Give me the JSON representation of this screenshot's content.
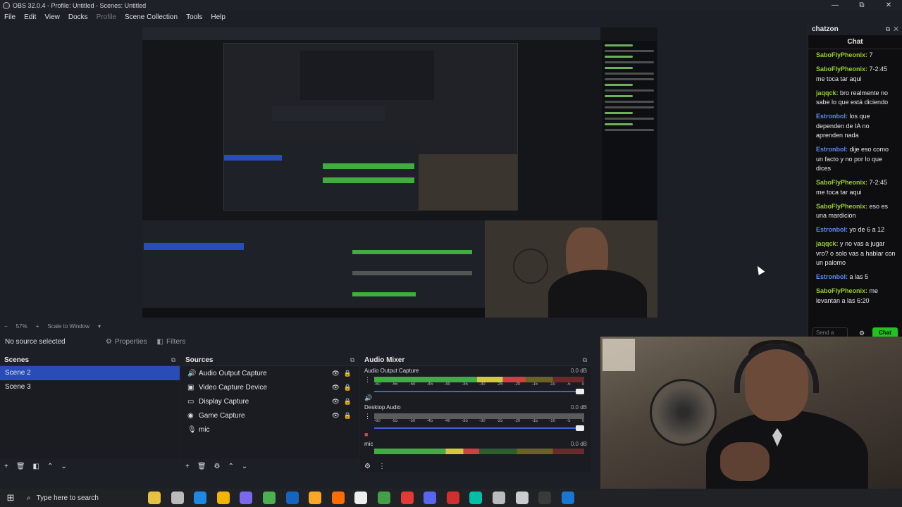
{
  "window": {
    "title": "OBS 32.0.4 - Profile: Untitled - Scenes: Untitled",
    "controls": [
      "—",
      "⧉",
      "✕"
    ]
  },
  "menu": {
    "items": [
      "File",
      "Edit",
      "View",
      "Docks",
      "Profile",
      "Scene Collection",
      "Tools",
      "Help"
    ]
  },
  "status_strip": {
    "zoom": "57%",
    "plus": "+",
    "scale": "Scale to Window"
  },
  "props_bar": {
    "no_source": "No source selected",
    "properties": "Properties",
    "filters": "Filters"
  },
  "scenes": {
    "title": "Scenes",
    "items": [
      "Scene 2",
      "Scene 3"
    ],
    "selected_index": 0
  },
  "sources": {
    "title": "Sources",
    "items": [
      {
        "label": "Audio Output Capture",
        "icon": "speaker-icon"
      },
      {
        "label": "Video Capture Device",
        "icon": "camera-icon"
      },
      {
        "label": "Display Capture",
        "icon": "monitor-icon"
      },
      {
        "label": "Game Capture",
        "icon": "gamepad-icon"
      },
      {
        "label": "mic",
        "icon": "mic-icon"
      }
    ]
  },
  "mixer": {
    "title": "Audio Mixer",
    "channels": [
      {
        "name": "Audio Output Capture",
        "db": "0.0 dB",
        "level": 0.72
      },
      {
        "name": "Desktop Audio",
        "db": "0.0 dB",
        "level": 0.0
      },
      {
        "name": "mic",
        "db": "0.0 dB",
        "level": 0.5
      }
    ],
    "scale": [
      "-60",
      "-55",
      "-50",
      "-45",
      "-40",
      "-35",
      "-30",
      "-25",
      "-20",
      "-15",
      "-10",
      "-5",
      "0"
    ]
  },
  "chat": {
    "dock_title": "chatzon",
    "header": "Chat",
    "messages": [
      {
        "user": "SaboFlyPheonix",
        "text": " 7",
        "color": "#9acd32"
      },
      {
        "user": "SaboFlyPheonix",
        "text": " 7-2:45 me toca tar aqui",
        "color": "#9acd32"
      },
      {
        "user": "jaqqck",
        "text": " bro realmente no sabe lo que está diciendo",
        "color": "#9acd32"
      },
      {
        "user": "Estronbol",
        "text": " los que dependen de IA no aprenden nada",
        "color": "#5a8dee"
      },
      {
        "user": "Estronbol",
        "text": " dije eso como un facto y no por lo que dices",
        "color": "#5a8dee"
      },
      {
        "user": "SaboFlyPheonix",
        "text": " 7-2:45 me toca tar aqui",
        "color": "#9acd32"
      },
      {
        "user": "SaboFlyPheonix",
        "text": " eso es una mardicion",
        "color": "#9acd32"
      },
      {
        "user": "Estronbol",
        "text": " yo de 6 a 12",
        "color": "#5a8dee"
      },
      {
        "user": "jaqqck",
        "text": " y no vas a jugar vro? o solo vas a hablar con un palomo",
        "color": "#9acd32"
      },
      {
        "user": "Estronbol",
        "text": " a las 5",
        "color": "#5a8dee"
      },
      {
        "user": "SaboFlyPheonix",
        "text": " me levantan a las 6:20",
        "color": "#9acd32"
      }
    ],
    "input_placeholder": "Send a",
    "send_label": "Chat"
  },
  "taskbar": {
    "search_placeholder": "Type here to search",
    "icon_colors": [
      "#e8c040",
      "#bbbbbb",
      "#1e88e5",
      "#f4b400",
      "#7b68ee",
      "#4caf50",
      "#1565c0",
      "#f9a825",
      "#ff6d00",
      "#eeeeee",
      "#43a047",
      "#e53935",
      "#5865f2",
      "#d32f2f",
      "#00bfa5",
      "#bbbbbb",
      "#cccccc",
      "#3a3a3a",
      "#1976d2"
    ]
  }
}
